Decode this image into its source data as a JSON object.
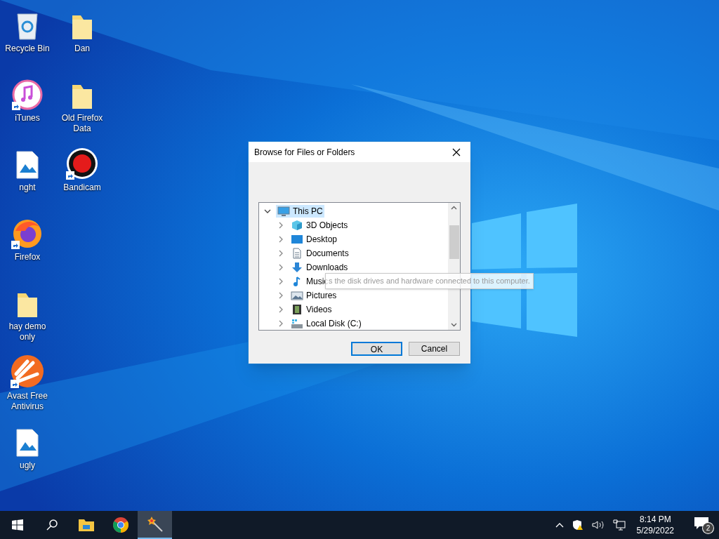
{
  "desktop": {
    "columns": [
      [
        {
          "label": "Recycle Bin",
          "kind": "recycle",
          "shortcut": false
        },
        {
          "label": "iTunes",
          "kind": "itunes",
          "shortcut": true
        },
        {
          "label": "nght",
          "kind": "image",
          "shortcut": false
        },
        {
          "label": "Firefox",
          "kind": "firefox",
          "shortcut": true
        },
        {
          "label": "hay demo only",
          "kind": "folder",
          "shortcut": false
        },
        {
          "label": "Avast Free Antivirus",
          "kind": "avast",
          "shortcut": true
        },
        {
          "label": "ugly",
          "kind": "image",
          "shortcut": false
        }
      ],
      [
        {
          "label": "Dan",
          "kind": "folder",
          "shortcut": false
        },
        {
          "label": "Old Firefox Data",
          "kind": "folder",
          "shortcut": false
        },
        {
          "label": "Bandicam",
          "kind": "bandicam",
          "shortcut": true
        }
      ]
    ]
  },
  "dialog": {
    "title": "Browse for Files or Folders",
    "tree": [
      {
        "label": "This PC",
        "kind": "pc",
        "expanded": true,
        "selected": true,
        "children": [
          {
            "label": "3D Objects",
            "kind": "cube",
            "expanded": false,
            "selected": false
          },
          {
            "label": "Desktop",
            "kind": "desktop",
            "expanded": false,
            "selected": false
          },
          {
            "label": "Documents",
            "kind": "document",
            "expanded": false,
            "selected": false
          },
          {
            "label": "Downloads",
            "kind": "download",
            "expanded": false,
            "selected": false
          },
          {
            "label": "Music",
            "kind": "music",
            "expanded": false,
            "selected": false
          },
          {
            "label": "Pictures",
            "kind": "pictures",
            "expanded": false,
            "selected": false
          },
          {
            "label": "Videos",
            "kind": "videos",
            "expanded": false,
            "selected": false
          },
          {
            "label": "Local Disk (C:)",
            "kind": "disk",
            "expanded": false,
            "selected": false
          }
        ]
      }
    ],
    "tooltip": "s the disk drives and hardware connected to this computer.",
    "buttons": [
      {
        "label": "OK",
        "default": true
      },
      {
        "label": "Cancel",
        "default": false
      }
    ]
  },
  "taskbar": {
    "apps": [
      {
        "kind": "start",
        "selected": false
      },
      {
        "kind": "search",
        "selected": false
      },
      {
        "kind": "explorer",
        "selected": false
      },
      {
        "kind": "chrome",
        "selected": false
      },
      {
        "kind": "wand",
        "selected": true
      }
    ],
    "time": "8:14 PM",
    "date": "5/29/2022",
    "notifications": "2"
  }
}
